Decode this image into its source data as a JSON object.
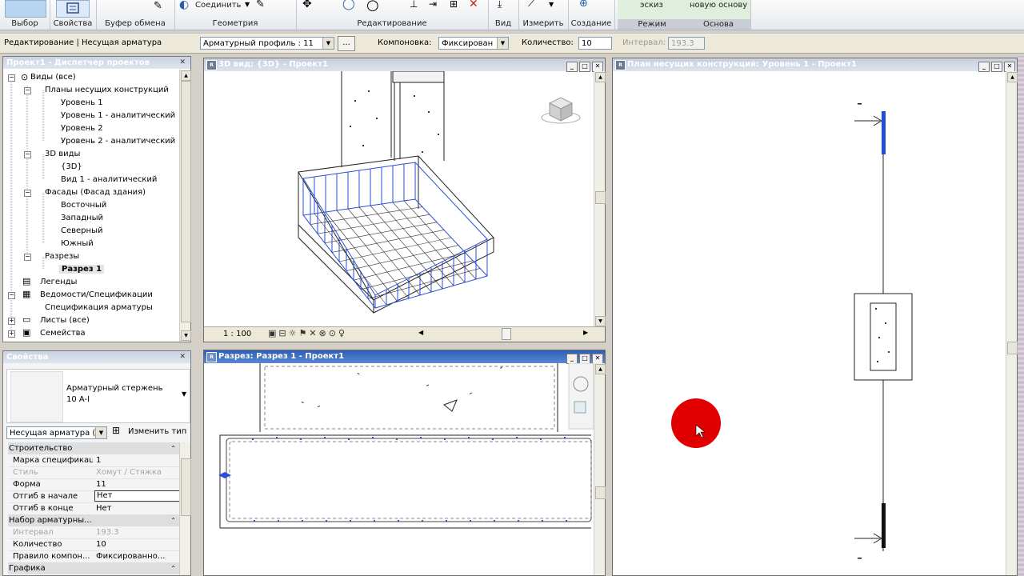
{
  "ribbon": {
    "btn_select": "Выбор",
    "btn_properties": "Свойства",
    "sec_clipboard": "Буфер обмена",
    "btn_join": "Соединить",
    "sec_geometry": "Геометрия",
    "sec_edit": "Редактирование",
    "sec_view": "Вид",
    "sec_measure": "Измерить",
    "sec_create": "Создание",
    "btn_sketch": "эскиз",
    "sec_mode": "Режим",
    "btn_new_host": "новую основу",
    "sec_host": "Основа"
  },
  "optbar": {
    "context": "Редактирование | Несущая арматура",
    "rebar_shape": "Арматурный профиль : 11",
    "more_button": "...",
    "layout_label": "Компоновка:",
    "layout_value": "Фиксирован",
    "quantity_label": "Количество:",
    "quantity_value": "10",
    "interval_label": "Интервал:",
    "interval_value": "193.3"
  },
  "browser": {
    "title": "Проект1 - Диспетчер проектов",
    "items": [
      {
        "label": "Виды (все)"
      },
      {
        "label": "Планы несущих конструкций"
      },
      {
        "label": "Уровень 1"
      },
      {
        "label": "Уровень 1 - аналитический"
      },
      {
        "label": "Уровень 2"
      },
      {
        "label": "Уровень 2 - аналитический"
      },
      {
        "label": "3D виды"
      },
      {
        "label": "{3D}"
      },
      {
        "label": "Вид 1 - аналитический"
      },
      {
        "label": "Фасады (Фасад здания)"
      },
      {
        "label": "Восточный"
      },
      {
        "label": "Западный"
      },
      {
        "label": "Северный"
      },
      {
        "label": "Южный"
      },
      {
        "label": "Разрезы"
      },
      {
        "label": "Разрез 1"
      },
      {
        "label": "Легенды"
      },
      {
        "label": "Ведомости/Спецификации"
      },
      {
        "label": "Спецификация арматуры"
      },
      {
        "label": "Листы (все)"
      },
      {
        "label": "Семейства"
      }
    ]
  },
  "properties": {
    "title": "Свойства",
    "type_name": "Арматурный стержень",
    "type_sub": "10 A-I",
    "filter_value": "Несущая арматура (",
    "edit_type": "Изменить тип",
    "groups": [
      {
        "label": "Строительство"
      },
      {
        "label": "Набор арматурны..."
      },
      {
        "label": "Графика"
      }
    ],
    "rows": [
      {
        "key": "Марка спецификац...",
        "value": "1"
      },
      {
        "key": "Стиль",
        "value": "Хомут / Стяжка"
      },
      {
        "key": "Форма",
        "value": "11"
      },
      {
        "key": "Отгиб в начале",
        "value": "Нет"
      },
      {
        "key": "Отгиб в конце",
        "value": "Нет"
      },
      {
        "key": "Интервал",
        "value": "193.3"
      },
      {
        "key": "Количество",
        "value": "10"
      },
      {
        "key": "Правило компон...",
        "value": "Фиксированно..."
      }
    ]
  },
  "views": {
    "view3d_title": "3D вид: {3D} - Проект1",
    "view3d_scale": "1 : 100",
    "section_title": "Разрез: Разрез 1 - Проект1",
    "plan_title": "План несущих конструкций: Уровень 1 - Проект1"
  },
  "colors": {
    "rebar_blue": "#1f4fd6",
    "active_title": "#2e5fb5",
    "cursor_marker": "#e00000"
  }
}
